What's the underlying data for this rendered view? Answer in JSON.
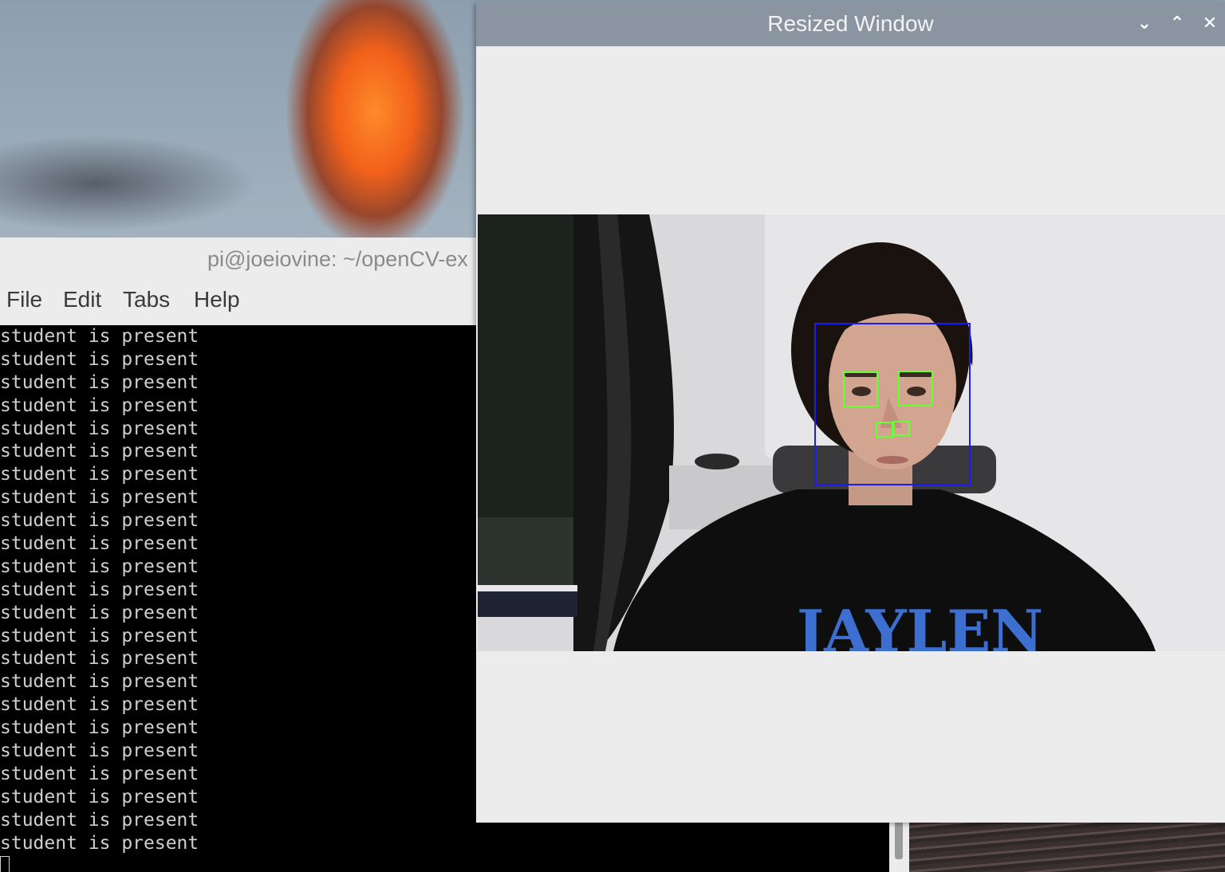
{
  "terminal": {
    "title": "pi@joeiovine: ~/openCV-ex",
    "menu": [
      "File",
      "Edit",
      "Tabs",
      "Help"
    ],
    "output_lines": [
      "student is present",
      "student is present",
      "student is present",
      "student is present",
      "student is present",
      "student is present",
      "student is present",
      "student is present",
      "student is present",
      "student is present",
      "student is present",
      "student is present",
      "student is present",
      "student is present",
      "student is present",
      "student is present",
      "student is present",
      "student is present",
      "student is present",
      "student is present",
      "student is present",
      "student is present",
      "student is present"
    ]
  },
  "cv_window": {
    "title": "Resized Window",
    "buttons": {
      "minimize_icon": "chevron-down-icon",
      "maximize_icon": "chevron-up-icon",
      "close_icon": "close-icon"
    },
    "shirt_text": "JAYLEN",
    "detection_colors": {
      "face_box": "#1a1aff",
      "eye_box": "#66ff33"
    }
  }
}
